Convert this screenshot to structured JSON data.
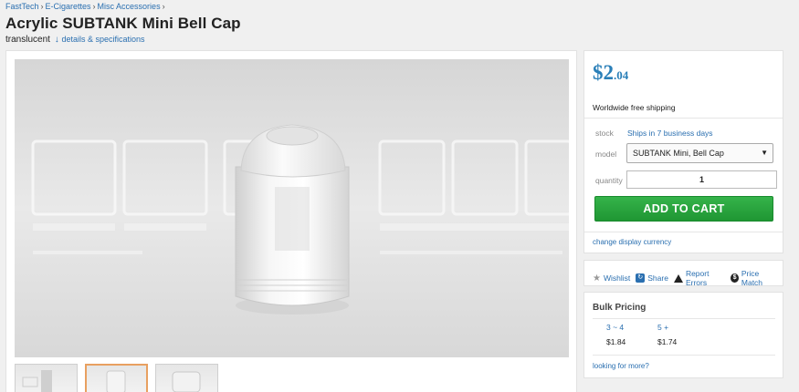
{
  "breadcrumb": [
    "FastTech",
    "E-Cigarettes",
    "Misc Accessories"
  ],
  "breadcrumb_sep": "›",
  "product": {
    "title": "Acrylic SUBTANK Mini Bell Cap",
    "variant": "translucent",
    "details_arrow": "↓",
    "details_link": "details & specifications"
  },
  "price": {
    "int": "$2",
    "cents": ".04"
  },
  "shipping": "Worldwide free shipping",
  "stock": {
    "label": "stock",
    "value": "Ships in 7 business days"
  },
  "model": {
    "label": "model",
    "selected": "SUBTANK Mini, Bell Cap"
  },
  "quantity": {
    "label": "quantity",
    "value": "1"
  },
  "add_to_cart": "ADD TO CART",
  "currency_link": "change display currency",
  "actions": {
    "wishlist": "Wishlist",
    "share": "Share",
    "report": "Report Errors",
    "price_match": "Price Match"
  },
  "bulk": {
    "title": "Bulk Pricing",
    "tiers": [
      "3 ~ 4",
      "5 +"
    ],
    "prices": [
      "$1.84",
      "$1.74"
    ],
    "more": "looking for more?"
  },
  "image": {
    "watermark": "FASTECH"
  },
  "colors": {
    "link": "#2a6fb0",
    "price": "#2a7fb8",
    "cart": "#2aa43f",
    "thumb_active": "#e8a060"
  }
}
